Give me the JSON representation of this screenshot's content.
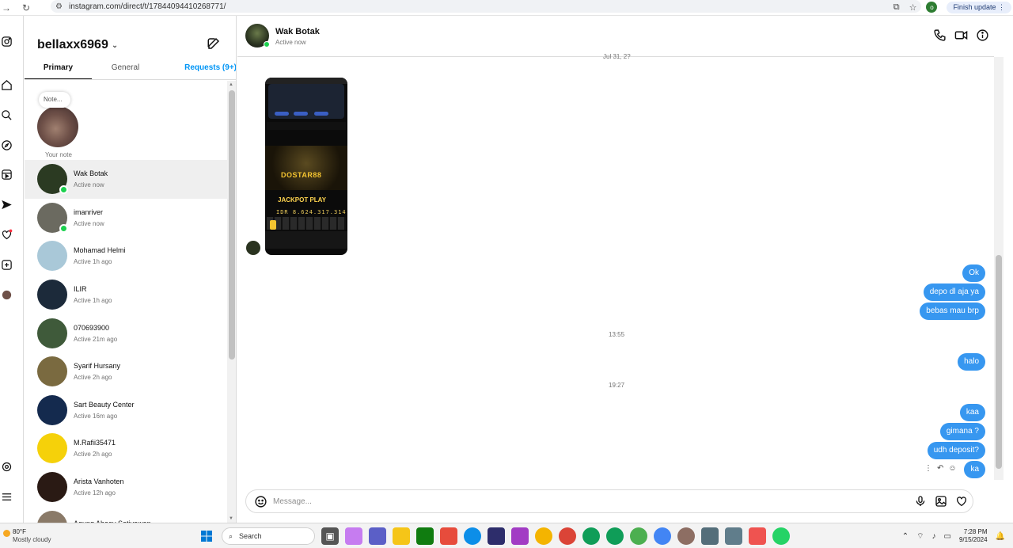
{
  "browser": {
    "url": "instagram.com/direct/t/17844094410268771/",
    "profile_initial": "o",
    "finish_update": "Finish update"
  },
  "sidebar": {
    "username": "bellaxx6969",
    "tabs": {
      "primary": "Primary",
      "general": "General",
      "requests": "Requests (9+)"
    },
    "note": {
      "bubble": "Note...",
      "label": "Your note"
    },
    "conversations": [
      {
        "name": "Wak Botak",
        "status": "Active now",
        "online": true,
        "active": true,
        "color": "#2b3a22"
      },
      {
        "name": "imanriver",
        "status": "Active now",
        "online": true,
        "active": false,
        "color": "#6b6a60"
      },
      {
        "name": "Mohamad Helmi",
        "status": "Active 1h ago",
        "online": false,
        "active": false,
        "color": "#a9c8d8"
      },
      {
        "name": "ILIR",
        "status": "Active 1h ago",
        "online": false,
        "active": false,
        "color": "#1c2a3a"
      },
      {
        "name": "070693900",
        "status": "Active 21m ago",
        "online": false,
        "active": false,
        "color": "#3f5a3a"
      },
      {
        "name": "Syarif Hursany",
        "status": "Active 2h ago",
        "online": false,
        "active": false,
        "color": "#7a6a40"
      },
      {
        "name": "Sart Beauty Center",
        "status": "Active 16m ago",
        "online": false,
        "active": false,
        "color": "#142a4e"
      },
      {
        "name": "M.Rafii35471",
        "status": "Active 2h ago",
        "online": false,
        "active": false,
        "color": "#f5d10a"
      },
      {
        "name": "Arista Vanhoten",
        "status": "Active 12h ago",
        "online": false,
        "active": false,
        "color": "#2a1a14"
      },
      {
        "name": "Agung Ahooy Setiyawan",
        "status": "",
        "online": false,
        "active": false,
        "color": "#8a7a68"
      }
    ]
  },
  "chat": {
    "contact_name": "Wak Botak",
    "contact_status": "Active now",
    "top_timestamp": "Jul 31, 2?",
    "screenshot": {
      "brand": "DOSTAR88",
      "jackpot": "JACKPOT PLAY",
      "amount": "IDR 8.624.317.314"
    },
    "sent_group1": [
      "Ok",
      "depo dl aja ya",
      "bebas mau brp"
    ],
    "timestamp1": "13:55",
    "sent_group2": [
      "halo"
    ],
    "timestamp2": "19:27",
    "sent_group3": [
      "kaa",
      "gimana ?",
      "udh deposit?",
      "ka"
    ],
    "composer_placeholder": "Message..."
  },
  "taskbar": {
    "temperature": "80°F",
    "weather": "Mostly cloudy",
    "search": "Search",
    "time": "7:28 PM",
    "date": "9/15/2024"
  },
  "colors": {
    "accent": "#0095f6",
    "bubble": "#3797f0",
    "online": "#1cd14f"
  }
}
